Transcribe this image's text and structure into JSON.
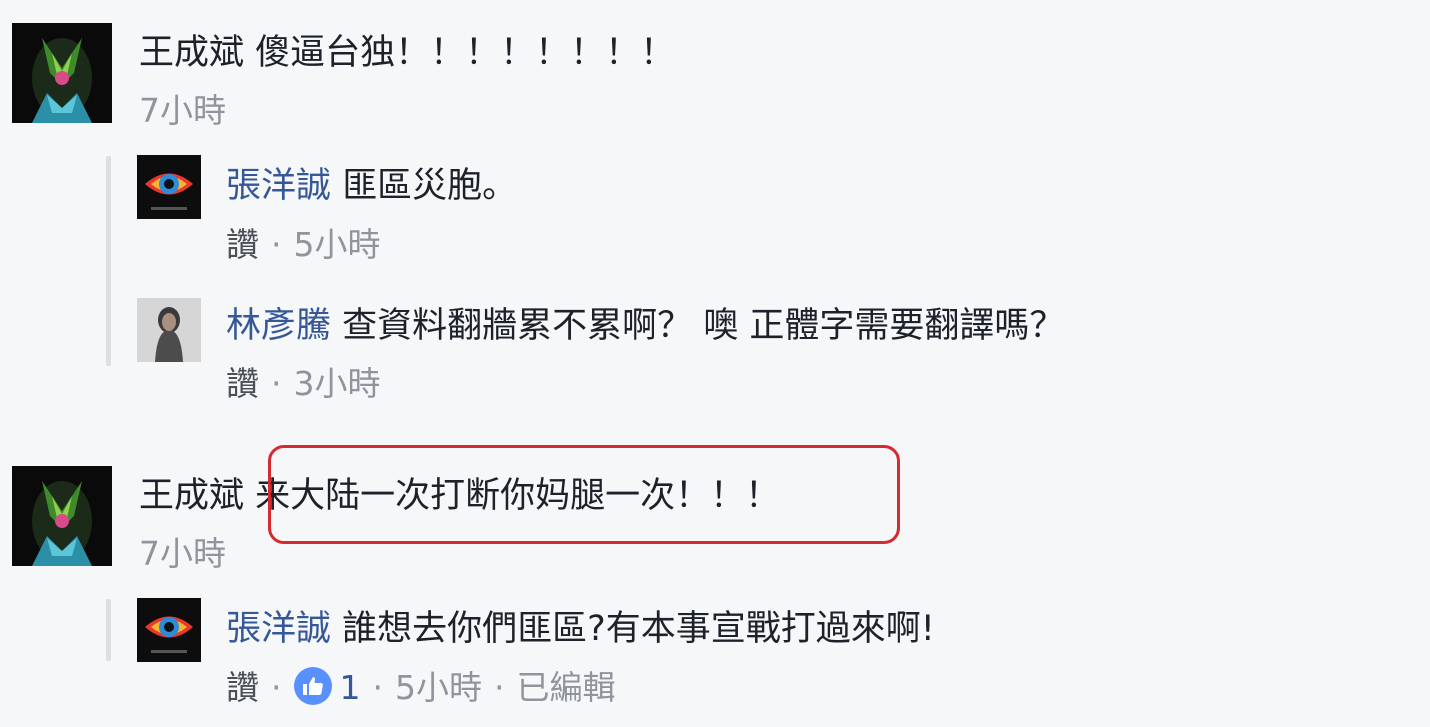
{
  "comments": [
    {
      "author": "王成斌",
      "text": "傻逼台独！！！！！！！！",
      "time": "7小時",
      "replies": [
        {
          "author": "張洋誠",
          "text": "匪區災胞。",
          "like_label": "讚",
          "time": "5小時"
        },
        {
          "author": "林彥騰",
          "text": "查資料翻牆累不累啊？ 噢 正體字需要翻譯嗎？",
          "like_label": "讚",
          "time": "3小時"
        }
      ]
    },
    {
      "author": "王成斌",
      "text": "来大陆一次打断你妈腿一次！！！",
      "time": "7小時",
      "replies": [
        {
          "author": "張洋誠",
          "text": "誰想去你們匪區?有本事宣戰打過來啊!",
          "like_label": "讚",
          "like_count": "1",
          "time": "5小時",
          "edited": "已編輯"
        }
      ]
    }
  ],
  "icons": {
    "like": "thumbs-up-icon"
  },
  "colors": {
    "background": "#f6f7f9",
    "author_link": "#365899",
    "highlight_border": "#d52b30",
    "like_badge": "#5890ff"
  }
}
